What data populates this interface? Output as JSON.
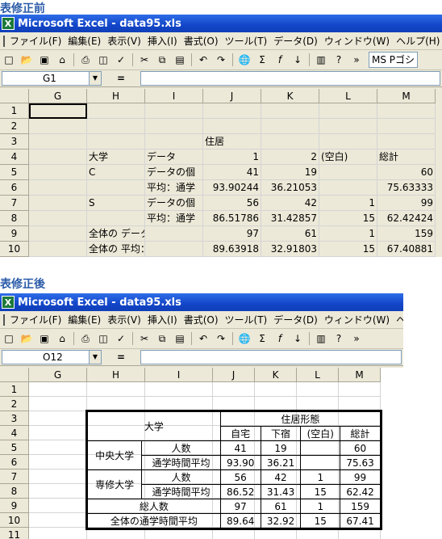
{
  "before": {
    "caption": "表修正前",
    "title": "Microsoft Excel - data95.xls",
    "menu": [
      "ファイル(F)",
      "編集(E)",
      "表示(V)",
      "挿入(I)",
      "書式(O)",
      "ツール(T)",
      "データ(D)",
      "ウィンドウ(W)",
      "ヘルプ(H)"
    ],
    "font": "MS Pゴシ",
    "namebox": "G1",
    "columns": [
      "G",
      "H",
      "I",
      "J",
      "K",
      "L",
      "M"
    ],
    "rows": [
      "1",
      "2",
      "3",
      "4",
      "5",
      "6",
      "7",
      "8",
      "9",
      "10"
    ],
    "cells": {
      "r3": {
        "J": "住居"
      },
      "r4": {
        "H": "大学",
        "I": "データ",
        "J": "1",
        "K": "2",
        "L": "(空白)",
        "M": "総計"
      },
      "r5": {
        "H": "C",
        "I": "データの個",
        "J": "41",
        "K": "19",
        "M": "60"
      },
      "r6": {
        "I": "平均：通学",
        "J": "93.90244",
        "K": "36.21053",
        "M": "75.63333"
      },
      "r7": {
        "H": "S",
        "I": "データの個",
        "J": "56",
        "K": "42",
        "L": "1",
        "M": "99"
      },
      "r8": {
        "I": "平均：通学",
        "J": "86.51786",
        "K": "31.42857",
        "L": "15",
        "M": "62.42424"
      },
      "r9": {
        "H": "全体の データの個数：",
        "J": "97",
        "K": "61",
        "L": "1",
        "M": "159"
      },
      "r10": {
        "H": "全体の 平均：通学時間",
        "J": "89.63918",
        "K": "32.91803",
        "L": "15",
        "M": "67.40881"
      }
    }
  },
  "after": {
    "caption": "表修正後",
    "title": "Microsoft Excel - data95.xls",
    "menu": [
      "ファイル(F)",
      "編集(E)",
      "表示(V)",
      "挿入(I)",
      "書式(O)",
      "ツール(T)",
      "データ(D)",
      "ウィンドウ(W)",
      "ヘルプ(H"
    ],
    "namebox": "O12",
    "columns": [
      "G",
      "H",
      "I",
      "J",
      "K",
      "L",
      "M"
    ],
    "rows": [
      "1",
      "2",
      "3",
      "4",
      "5",
      "6",
      "7",
      "8",
      "9",
      "10",
      "11"
    ],
    "table": {
      "univ_header": "大学",
      "residence_header": "住居形態",
      "sub_headers": [
        "自宅",
        "下宿",
        "(空白)",
        "総計"
      ],
      "groups": [
        {
          "name": "中央大学",
          "rows": [
            {
              "label": "人数",
              "values": [
                "41",
                "19",
                "",
                "60"
              ]
            },
            {
              "label": "通学時間平均",
              "values": [
                "93.90",
                "36.21",
                "",
                "75.63"
              ]
            }
          ]
        },
        {
          "name": "専修大学",
          "rows": [
            {
              "label": "人数",
              "values": [
                "56",
                "42",
                "1",
                "99"
              ]
            },
            {
              "label": "通学時間平均",
              "values": [
                "86.52",
                "31.43",
                "15",
                "62.42"
              ]
            }
          ]
        }
      ],
      "totals": [
        {
          "label": "総人数",
          "values": [
            "97",
            "61",
            "1",
            "159"
          ]
        },
        {
          "label": "全体の通学時間平均",
          "values": [
            "89.64",
            "32.92",
            "15",
            "67.41"
          ]
        }
      ]
    }
  }
}
